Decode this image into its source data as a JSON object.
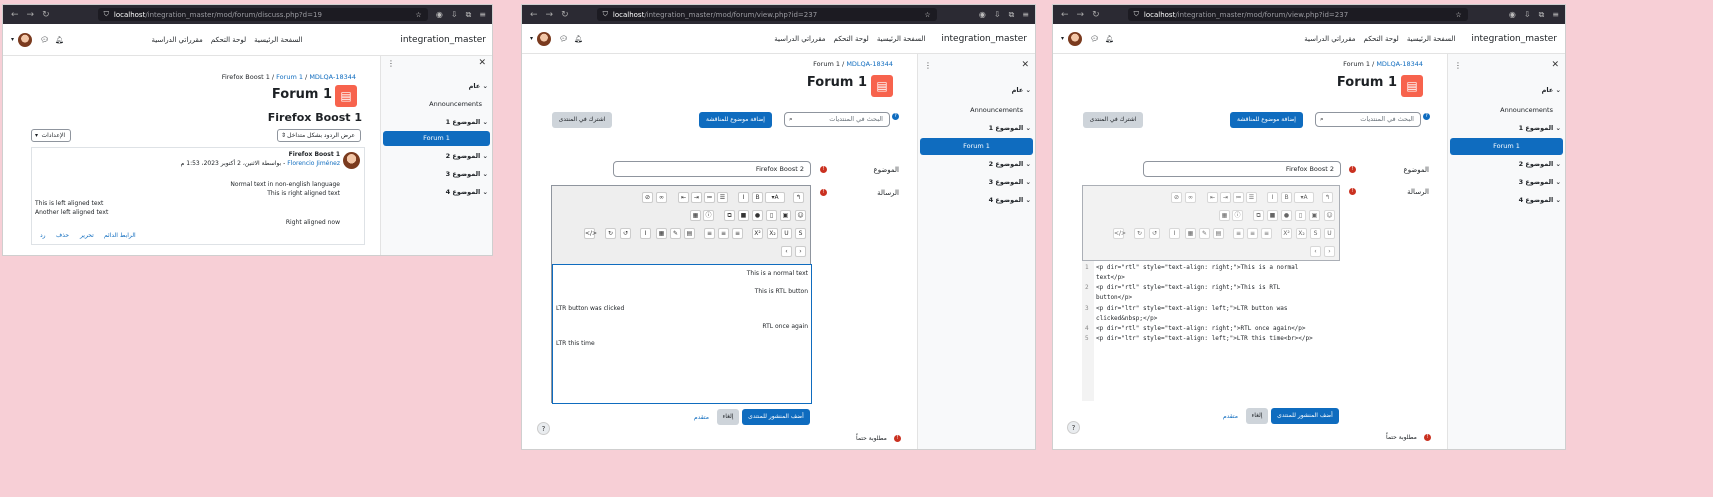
{
  "window1": {
    "url_host": "localhost",
    "url_path": "/integration_master/mod/forum/discuss.php?d=19",
    "site_name": "integration_master",
    "nav": [
      "السفحة الرئيسية",
      "لوحة التحكم",
      "مقرراتي الدراسية"
    ],
    "breadcrumb": [
      "Firefox Boost 1",
      "Forum 1",
      "MDLQA-18344"
    ],
    "page_title": "Forum 1",
    "discussion_title": "Firefox Boost 1",
    "display_mode": "عرض الردود بشكل متداخل",
    "settings_label": "الإعدادات",
    "post": {
      "subject": "Firefox Boost 1",
      "byline": "بواسطة الاثنين، 2 أكتوبر 2023، 1:53 م - ",
      "author": "Florencio Jiménez",
      "lines": [
        "Normal text in non-english language",
        "This is right aligned text",
        "This is left aligned text",
        "Another left aligned text",
        "Right aligned now"
      ],
      "actions": [
        "الرابط الدائم",
        "تحرير",
        "حذف",
        "رد"
      ]
    },
    "drawer": {
      "general": "عام",
      "announcements": "Announcements",
      "topics": [
        "الموضوع 1",
        "Forum 1",
        "الموضوع 2",
        "الموضوع 3",
        "الموضوع 4"
      ]
    }
  },
  "window2": {
    "url_host": "localhost",
    "url_path": "/integration_master/mod/forum/view.php?id=237",
    "site_name": "integration_master",
    "nav": [
      "السفحة الرئيسية",
      "لوحة التحكم",
      "مقرراتي الدراسية"
    ],
    "breadcrumb": [
      "Forum 1",
      "MDLQA-18344"
    ],
    "page_title": "Forum 1",
    "subscribe": "اشترك في المنتدى",
    "add_topic": "إضافة موضوع للمناقشة",
    "search_placeholder": "البحث في المنتديات",
    "subject_label": "الموضوع",
    "subject_value": "Firefox Boost 2",
    "message_label": "الرسالة",
    "content": [
      "This is a normal text",
      "This is RTL button",
      "LTR button was clicked",
      "RTL once again",
      "LTR this time"
    ],
    "post_btn": "أضف المنشور للمنتدى",
    "cancel_btn": "إلغاء",
    "advanced": "متقدم",
    "required": "مطلوبة حتماً",
    "drawer": {
      "general": "عام",
      "announcements": "Announcements",
      "topics": [
        "الموضوع 1",
        "Forum 1",
        "الموضوع 2",
        "الموضوع 3",
        "الموضوع 4"
      ]
    }
  },
  "window3": {
    "url_host": "localhost",
    "url_path": "/integration_master/mod/forum/view.php?id=237",
    "site_name": "integration_master",
    "nav": [
      "السفحة الرئيسية",
      "لوحة التحكم",
      "مقرراتي الدراسية"
    ],
    "breadcrumb": [
      "Forum 1",
      "MDLQA-18344"
    ],
    "page_title": "Forum 1",
    "subscribe": "اشترك في المنتدى",
    "add_topic": "إضافة موضوع للمناقشة",
    "search_placeholder": "البحث في المنتديات",
    "subject_label": "الموضوع",
    "subject_value": "Firefox Boost 2",
    "message_label": "الرسالة",
    "code_lines": [
      "<p dir=\"rtl\" style=\"text-align: right;\">This is a normal",
      "text</p>",
      "<p dir=\"rtl\" style=\"text-align: right;\">This is RTL",
      "button</p>",
      "<p dir=\"ltr\" style=\"text-align: left;\">LTR button was",
      "clicked&nbsp;</p>",
      "<p dir=\"rtl\" style=\"text-align: right;\">RTL once again</p>",
      "<p dir=\"ltr\" style=\"text-align: left;\">LTR this time<br></p>"
    ],
    "line_numbers": [
      "1",
      "",
      "2",
      "",
      "3",
      "",
      "4",
      "5"
    ],
    "post_btn": "أضف المنشور للمنتدى",
    "cancel_btn": "إلغاء",
    "advanced": "متقدم",
    "required": "مطلوبة حتماً",
    "drawer": {
      "general": "عام",
      "announcements": "Announcements",
      "topics": [
        "الموضوع 1",
        "Forum 1",
        "الموضوع 2",
        "الموضوع 3",
        "الموضوع 4"
      ]
    }
  }
}
